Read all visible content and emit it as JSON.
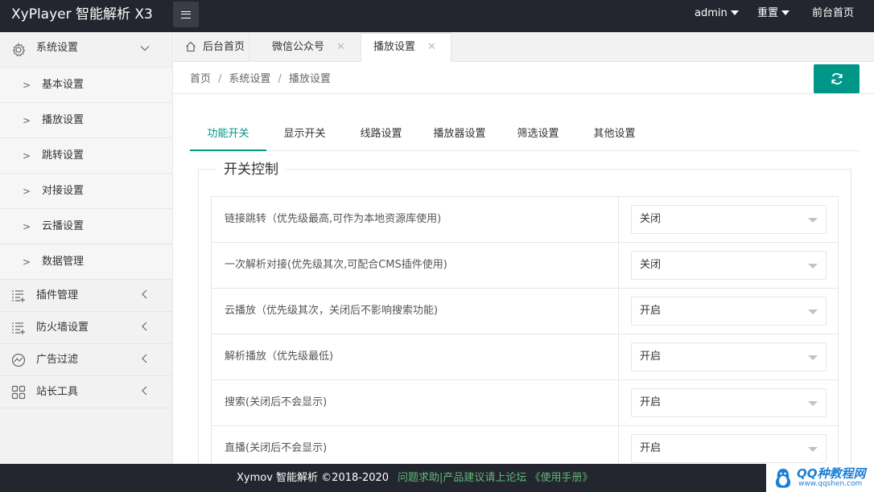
{
  "header": {
    "logo": "XyPlayer 智能解析 X3",
    "user": "admin",
    "reset": "重置",
    "frontend": "前台首页"
  },
  "sidebar": {
    "system": "系统设置",
    "items": [
      "基本设置",
      "播放设置",
      "跳转设置",
      "对接设置",
      "云播设置",
      "数据管理"
    ],
    "plugins": "插件管理",
    "firewall": "防火墙设置",
    "ads": "广告过滤",
    "tools": "站长工具"
  },
  "tabs": {
    "home": "后台首页",
    "wechat": "微信公众号",
    "play": "播放设置"
  },
  "breadcrumb": [
    "首页",
    "系统设置",
    "播放设置"
  ],
  "inner_tabs": [
    "功能开关",
    "显示开关",
    "线路设置",
    "播放器设置",
    "筛选设置",
    "其他设置"
  ],
  "section": {
    "legend": "开关控制",
    "rows": [
      {
        "label": "链接跳转（优先级最高,可作为本地资源库使用)",
        "value": "关闭"
      },
      {
        "label": "一次解析对接(优先级其次,可配合CMS插件使用)",
        "value": "关闭"
      },
      {
        "label": "云播放（优先级其次，关闭后不影响搜索功能)",
        "value": "开启"
      },
      {
        "label": "解析播放（优先级最低)",
        "value": "开启"
      },
      {
        "label": "搜索(关闭后不会显示)",
        "value": "开启"
      },
      {
        "label": "直播(关闭后不会显示)",
        "value": "开启"
      }
    ]
  },
  "footer": {
    "copyright": "Xymov 智能解析 ©2018-2020",
    "links": "问题求助|产品建议请上论坛 《使用手册》"
  },
  "watermark": {
    "title": "QQ种教程网",
    "url": "www.qqshen.com"
  },
  "colors": {
    "header_bg": "#23262e",
    "accent": "#009688",
    "footer_link": "#5fb878"
  }
}
